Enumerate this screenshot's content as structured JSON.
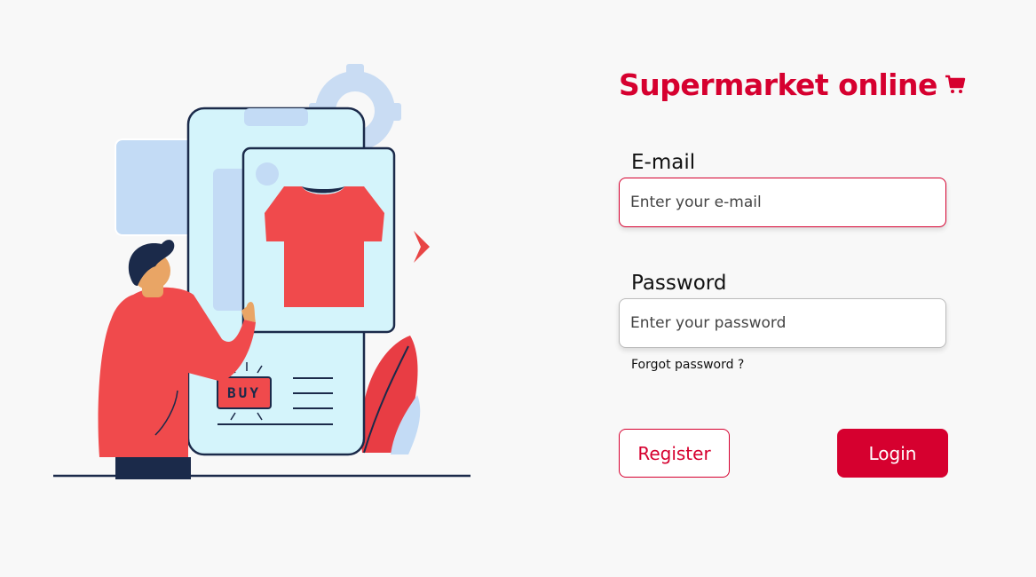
{
  "brand": {
    "title": "Supermarket online",
    "icon": "shopping-cart-icon",
    "color": "#d6002f"
  },
  "form": {
    "email_label": "E-mail",
    "email_placeholder": "Enter your e-mail",
    "password_label": "Password",
    "password_placeholder": "Enter your password",
    "forgot_password": "Forgot password ?",
    "register_label": "Register",
    "login_label": "Login"
  },
  "illustration": {
    "buy_badge": "BUY"
  }
}
